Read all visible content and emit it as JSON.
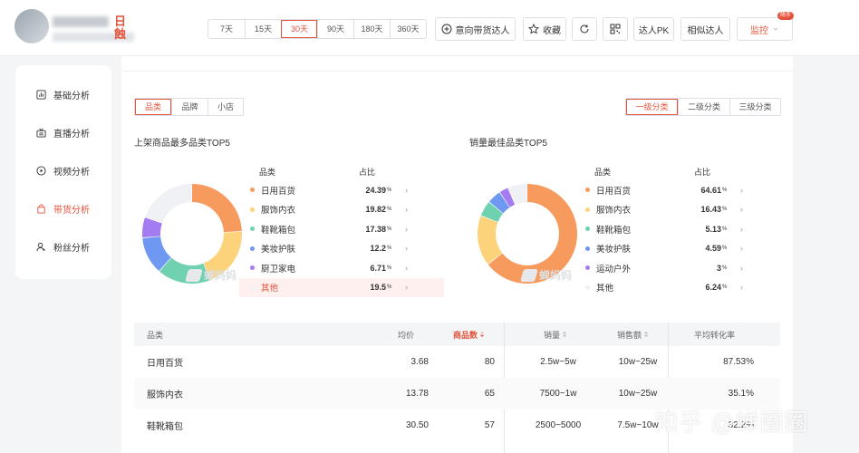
{
  "header": {
    "name_tag": "日蝕",
    "day_ranges": [
      "7天",
      "15天",
      "30天",
      "90天",
      "180天",
      "360天"
    ],
    "active_range": "30天",
    "intent_button": "意向带货达人",
    "favorite_button": "收藏",
    "pk_button": "达人PK",
    "similar_button": "相似达人",
    "monitor_button": "监控",
    "monitor_badge": "随手"
  },
  "sidebar": {
    "items": [
      {
        "label": "基础分析",
        "icon": "bar-chart-icon",
        "active": false
      },
      {
        "label": "直播分析",
        "icon": "broadcast-icon",
        "active": false
      },
      {
        "label": "视频分析",
        "icon": "play-circle-icon",
        "active": false
      },
      {
        "label": "带货分析",
        "icon": "shopping-bag-icon",
        "active": true
      },
      {
        "label": "粉丝分析",
        "icon": "user-icon",
        "active": false
      }
    ]
  },
  "filters": {
    "dimension_tabs": [
      "品类",
      "品牌",
      "小店"
    ],
    "active_dimension": "品类",
    "level_tabs": [
      "一级分类",
      "二级分类",
      "三级分类"
    ],
    "active_level": "一级分类"
  },
  "watermark": "蝉妈妈",
  "chart_data": [
    {
      "type": "pie",
      "title": "上架商品最多品类TOP5",
      "legend_header": {
        "category": "品类",
        "share": "占比"
      },
      "unit": "%",
      "slices": [
        {
          "label": "日用百货",
          "value": 24.39,
          "color": "#f79a5e"
        },
        {
          "label": "服饰内衣",
          "value": 19.82,
          "color": "#fcd27a"
        },
        {
          "label": "鞋靴箱包",
          "value": 17.38,
          "color": "#6fd1b0"
        },
        {
          "label": "美妆护肤",
          "value": 12.2,
          "color": "#6f98f2"
        },
        {
          "label": "厨卫家电",
          "value": 6.71,
          "color": "#a47bf0"
        },
        {
          "label": "其他",
          "value": 19.5,
          "color": "#f0f1f5"
        }
      ],
      "highlighted": "其他"
    },
    {
      "type": "pie",
      "title": "销量最佳品类TOP5",
      "legend_header": {
        "category": "品类",
        "share": "占比"
      },
      "unit": "%",
      "slices": [
        {
          "label": "日用百货",
          "value": 64.61,
          "color": "#f79a5e"
        },
        {
          "label": "服饰内衣",
          "value": 16.43,
          "color": "#fcd27a"
        },
        {
          "label": "鞋靴箱包",
          "value": 5.13,
          "color": "#6fd1b0"
        },
        {
          "label": "美妆护肤",
          "value": 4.59,
          "color": "#6f98f2"
        },
        {
          "label": "运动户外",
          "value": 3,
          "color": "#a47bf0"
        },
        {
          "label": "其他",
          "value": 6.24,
          "color": "#f0f1f5"
        }
      ]
    }
  ],
  "table": {
    "headers": {
      "category": "品类",
      "avg_price": "均价",
      "product_count": "商品数",
      "sales_volume": "销量",
      "sales_amount": "销售额",
      "conversion": "平均转化率"
    },
    "sort_column": "商品数",
    "rows": [
      {
        "category": "日用百货",
        "avg_price": "3.68",
        "product_count": "80",
        "sales_volume": "2.5w~5w",
        "sales_amount": "10w~25w",
        "conversion": "87.53%"
      },
      {
        "category": "服饰内衣",
        "avg_price": "13.78",
        "product_count": "65",
        "sales_volume": "7500~1w",
        "sales_amount": "10w~25w",
        "conversion": "35.1%"
      },
      {
        "category": "鞋靴箱包",
        "avg_price": "30.50",
        "product_count": "57",
        "sales_volume": "2500~5000",
        "sales_amount": "7.5w~10w",
        "conversion": "32.2%"
      }
    ]
  },
  "overlay_watermark": "知乎 @蝉圈圈"
}
